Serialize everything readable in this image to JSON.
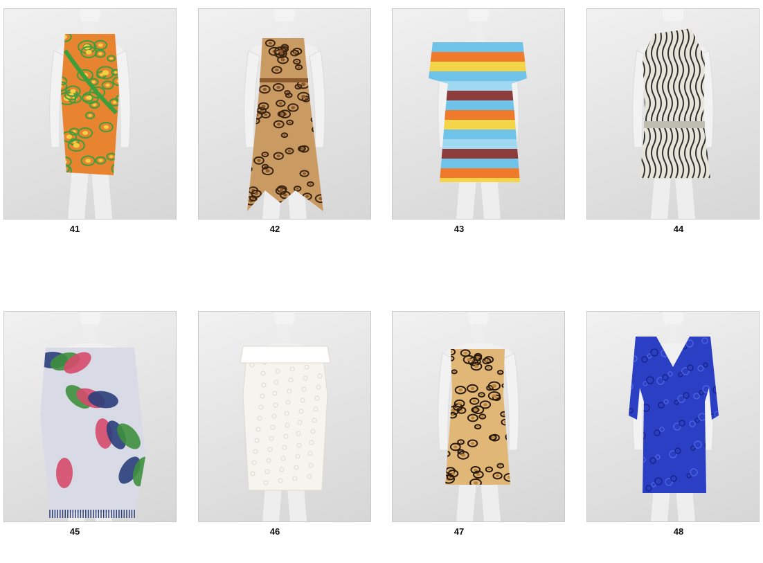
{
  "products": [
    {
      "number": "41",
      "description": "Floral print wrap dress",
      "palette": {
        "main": "#e8832f",
        "accent": "#3f9e3c",
        "alt": "#f1d043"
      }
    },
    {
      "number": "42",
      "description": "Leopard print handkerchief dress",
      "palette": {
        "main": "#8a5a2e",
        "accent": "#3a2410",
        "alt": "#c99a61"
      }
    },
    {
      "number": "43",
      "description": "Rainbow stripe blouson dress",
      "palette": {
        "main": "#6fc3e8",
        "accent": "#f07a2c",
        "alt": "#8c3c3a"
      }
    },
    {
      "number": "44",
      "description": "Black and white wave print halter dress",
      "palette": {
        "main": "#bfbcb1",
        "accent": "#2e2e2e",
        "alt": "#e7e4da"
      }
    },
    {
      "number": "45",
      "description": "Tropical leaf print fringe kaftan",
      "palette": {
        "main": "#3e8f3e",
        "accent": "#2a3e7a",
        "alt": "#d8dbe6"
      }
    },
    {
      "number": "46",
      "description": "White lace tunic dress",
      "palette": {
        "main": "#f6f4ee",
        "accent": "#dedad0",
        "alt": "#ffffff"
      }
    },
    {
      "number": "47",
      "description": "Strapless leopard print mini dress",
      "palette": {
        "main": "#b98240",
        "accent": "#2a1a0c",
        "alt": "#e0b777"
      }
    },
    {
      "number": "48",
      "description": "Royal blue lace sheath dress",
      "palette": {
        "main": "#2b3fc4",
        "accent": "#18248a",
        "alt": "#4a62e0"
      }
    }
  ]
}
